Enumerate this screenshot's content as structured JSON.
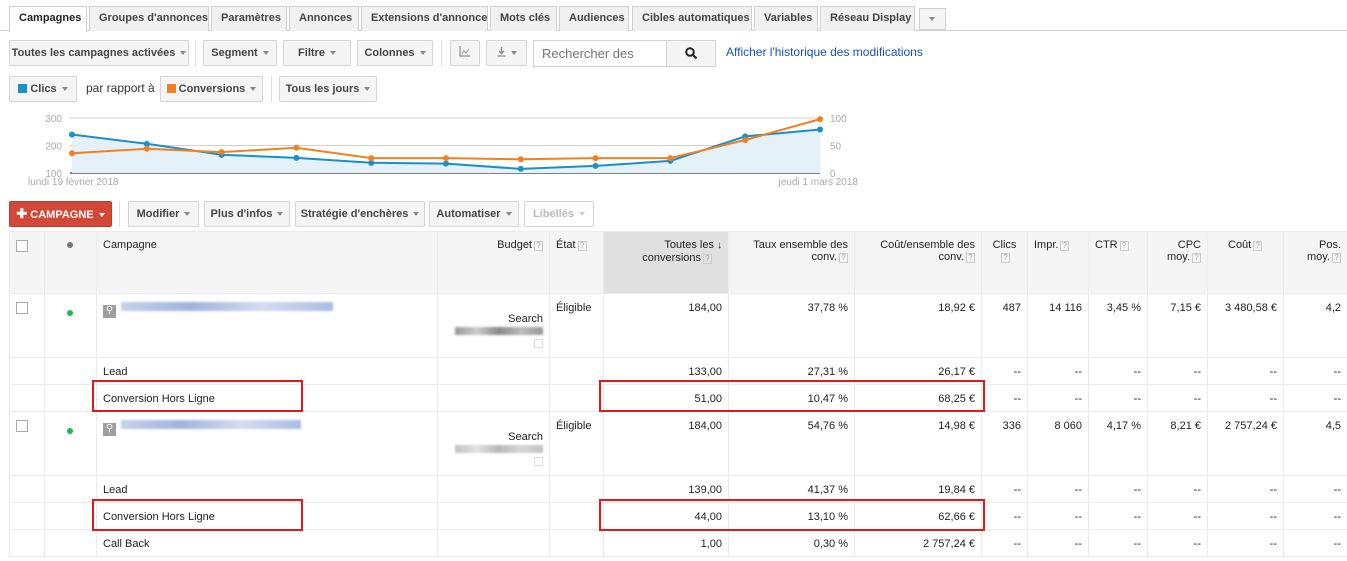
{
  "tabs": [
    {
      "label": "Campagnes",
      "active": true
    },
    {
      "label": "Groupes d'annonces"
    },
    {
      "label": "Paramètres"
    },
    {
      "label": "Annonces"
    },
    {
      "label": "Extensions d'annonce"
    },
    {
      "label": "Mots clés"
    },
    {
      "label": "Audiences"
    },
    {
      "label": "Cibles automatiques"
    },
    {
      "label": "Variables"
    },
    {
      "label": "Réseau Display"
    }
  ],
  "toolbar": {
    "filter_campaigns": "Toutes les campagnes activées",
    "segment": "Segment",
    "filter": "Filtre",
    "columns": "Colonnes",
    "search_placeholder": "Rechercher des",
    "history_link": "Afficher l'historique des modifications"
  },
  "chart_controls": {
    "metric1": "Clics",
    "compare_label": "par rapport à",
    "metric2": "Conversions",
    "period": "Tous les jours"
  },
  "colors": {
    "clics": "#1a8fc9",
    "conversions": "#f08020",
    "campaign_button": "#d14836",
    "highlight": "#e0191b",
    "eligible_dot": "#1db954",
    "link": "#1a4fc4"
  },
  "chart_data": {
    "type": "line",
    "x_start_label": "lundi 19 février 2018",
    "x_end_label": "jeudi 1 mars 2018",
    "x": [
      "2018-02-19",
      "2018-02-20",
      "2018-02-21",
      "2018-02-22",
      "2018-02-23",
      "2018-02-24",
      "2018-02-25",
      "2018-02-26",
      "2018-02-27",
      "2018-02-28",
      "2018-03-01"
    ],
    "left_axis": {
      "ticks": [
        100,
        200,
        300
      ],
      "ylim": [
        100,
        300
      ]
    },
    "right_axis": {
      "ticks": [
        0,
        50,
        100
      ],
      "ylim": [
        0,
        100
      ]
    },
    "grid": true,
    "series": [
      {
        "name": "Clics",
        "axis": "left",
        "area": true,
        "values": [
          240,
          206,
          166,
          155,
          137,
          134,
          115,
          126,
          144,
          233,
          258
        ]
      },
      {
        "name": "Conversions",
        "axis": "right",
        "area": false,
        "values": [
          36,
          44,
          38,
          46,
          27,
          27,
          25,
          27,
          27,
          60,
          98
        ]
      }
    ]
  },
  "actions": {
    "new_campaign": "CAMPAGNE",
    "modify": "Modifier",
    "more_info": "Plus d'infos",
    "bid_strategy": "Stratégie d'enchères",
    "automate": "Automatiser",
    "labels": "Libellés"
  },
  "table": {
    "headers": {
      "campaign": "Campagne",
      "budget": "Budget",
      "state": "État",
      "all_conv_1": "Toutes les",
      "all_conv_2": "conversions",
      "conv_rate_1": "Taux ensemble des",
      "conv_rate_2": "conv.",
      "cost_conv_1": "Coût/ensemble des",
      "cost_conv_2": "conv.",
      "clicks": "Clics",
      "impr": "Impr.",
      "ctr": "CTR",
      "cpc_1": "CPC",
      "cpc_2": "moy.",
      "cost": "Coût",
      "pos_1": "Pos.",
      "pos_2": "moy."
    },
    "campaigns": [
      {
        "budget_type": "Search",
        "state": "Éligible",
        "all_conv": "184,00",
        "conv_rate": "37,78 %",
        "cost_conv": "18,92 €",
        "clicks": "487",
        "impr": "14 116",
        "ctr": "3,45 %",
        "cpc": "7,15 €",
        "cost": "3 480,58 €",
        "pos": "4,2",
        "sub": [
          {
            "name": "Lead",
            "all_conv": "133,00",
            "conv_rate": "27,31 %",
            "cost_conv": "26,17 €",
            "dash": "--"
          },
          {
            "name": "Conversion Hors Ligne",
            "all_conv": "51,00",
            "conv_rate": "10,47 %",
            "cost_conv": "68,25 €",
            "dash": "--"
          }
        ]
      },
      {
        "budget_type": "Search",
        "state": "Éligible",
        "all_conv": "184,00",
        "conv_rate": "54,76 %",
        "cost_conv": "14,98 €",
        "clicks": "336",
        "impr": "8 060",
        "ctr": "4,17 %",
        "cpc": "8,21 €",
        "cost": "2 757,24 €",
        "pos": "4,5",
        "sub": [
          {
            "name": "Lead",
            "all_conv": "139,00",
            "conv_rate": "41,37 %",
            "cost_conv": "19,84 €",
            "dash": "--"
          },
          {
            "name": "Conversion Hors Ligne",
            "all_conv": "44,00",
            "conv_rate": "13,10 %",
            "cost_conv": "62,66 €",
            "dash": "--"
          },
          {
            "name": "Call Back",
            "all_conv": "1,00",
            "conv_rate": "0,30 %",
            "cost_conv": "2 757,24 €",
            "dash": "--"
          }
        ]
      }
    ]
  }
}
